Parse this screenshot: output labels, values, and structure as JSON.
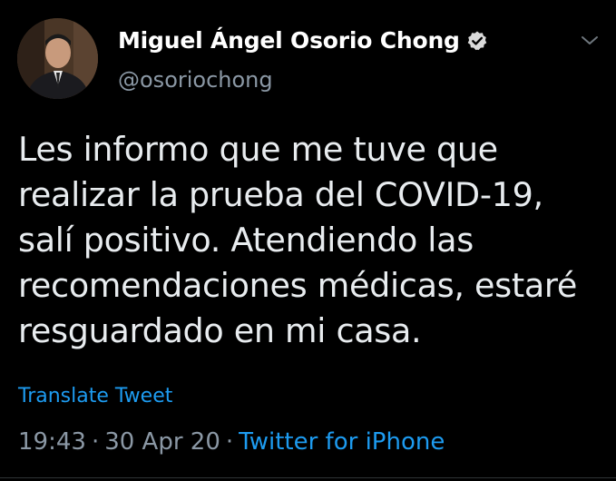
{
  "user": {
    "name": "Miguel Ángel Osorio Chong",
    "handle": "@osoriochong",
    "verified": true,
    "avatar": "profile-photo"
  },
  "tweet": {
    "text": "Les informo que me tuve que realizar la prueba del COVID-19, salí positivo. Atendiendo las recomendaciones médicas, estaré resguardado en mi casa.",
    "translate_label": "Translate Tweet",
    "time": "19:43",
    "separator": "·",
    "date": "30 Apr 20",
    "source": "Twitter for iPhone"
  },
  "icons": {
    "verified": "verified-badge-icon",
    "menu": "chevron-down-icon"
  },
  "colors": {
    "background": "#000000",
    "primary_text": "#ffffff",
    "secondary_text": "#8b98a5",
    "link": "#1d9bf0"
  }
}
